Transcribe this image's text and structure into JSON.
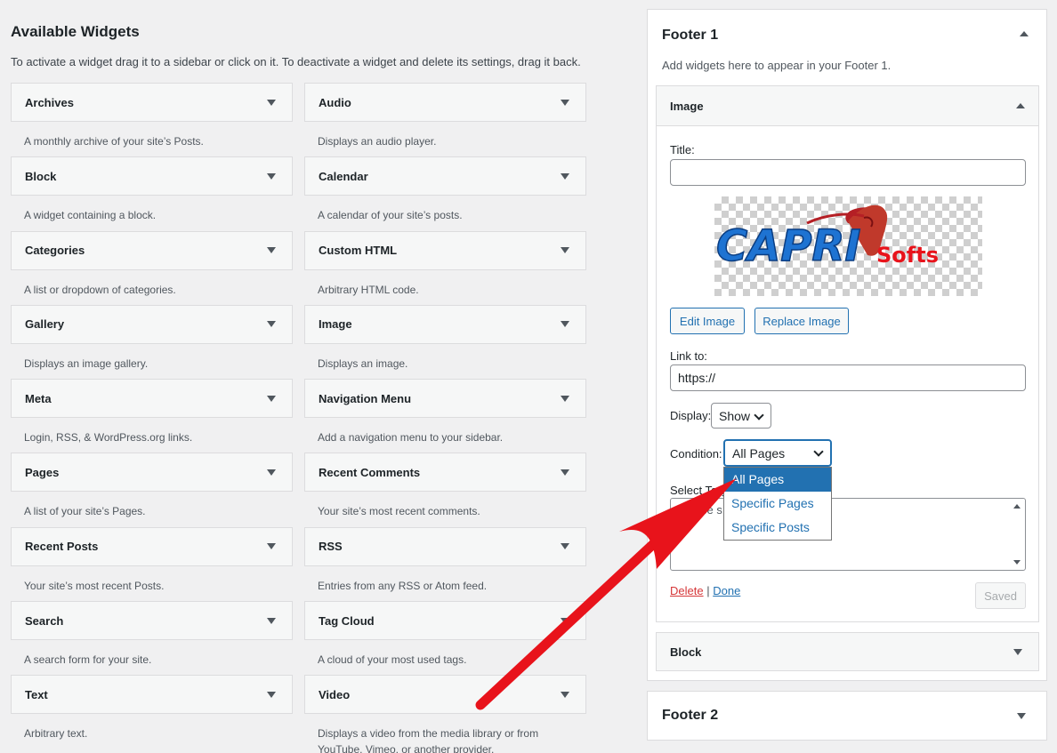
{
  "available": {
    "title": "Available Widgets",
    "description": "To activate a widget drag it to a sidebar or click on it. To deactivate a widget and delete its settings, drag it back."
  },
  "widgets": [
    {
      "name": "Archives",
      "desc": "A monthly archive of your site’s Posts."
    },
    {
      "name": "Audio",
      "desc": "Displays an audio player."
    },
    {
      "name": "Block",
      "desc": "A widget containing a block."
    },
    {
      "name": "Calendar",
      "desc": "A calendar of your site’s posts."
    },
    {
      "name": "Categories",
      "desc": "A list or dropdown of categories."
    },
    {
      "name": "Custom HTML",
      "desc": "Arbitrary HTML code."
    },
    {
      "name": "Gallery",
      "desc": "Displays an image gallery."
    },
    {
      "name": "Image",
      "desc": "Displays an image."
    },
    {
      "name": "Meta",
      "desc": "Login, RSS, & WordPress.org links."
    },
    {
      "name": "Navigation Menu",
      "desc": "Add a navigation menu to your sidebar."
    },
    {
      "name": "Pages",
      "desc": "A list of your site’s Pages."
    },
    {
      "name": "Recent Comments",
      "desc": "Your site’s most recent comments."
    },
    {
      "name": "Recent Posts",
      "desc": "Your site’s most recent Posts."
    },
    {
      "name": "RSS",
      "desc": "Entries from any RSS or Atom feed."
    },
    {
      "name": "Search",
      "desc": "A search form for your site."
    },
    {
      "name": "Tag Cloud",
      "desc": "A cloud of your most used tags."
    },
    {
      "name": "Text",
      "desc": "Arbitrary text."
    },
    {
      "name": "Video",
      "desc": "Displays a video from the media library or from YouTube, Vimeo, or another provider."
    }
  ],
  "footer1": {
    "title": "Footer 1",
    "description": "Add widgets here to appear in your Footer 1.",
    "image_widget": {
      "title": "Image",
      "title_label": "Title:",
      "title_value": "",
      "logo_text_main": "CAPRI",
      "logo_text_sub": "Softs",
      "edit_button": "Edit Image",
      "replace_button": "Replace Image",
      "link_label": "Link to:",
      "link_value": "https://",
      "display_label": "Display:",
      "display_value": "Show",
      "condition_label": "Condition:",
      "condition_value": "All Pages",
      "condition_options": [
        "All Pages",
        "Specific Pages",
        "Specific Posts"
      ],
      "select_target_label": "Select Targ",
      "textarea_placeholder": "Please s",
      "delete_link": "Delete",
      "separator": "|",
      "done_link": "Done",
      "saved_button": "Saved"
    },
    "block_widget": {
      "title": "Block"
    }
  },
  "footer2": {
    "title": "Footer 2"
  },
  "colors": {
    "accent": "#2271b1",
    "arrow": "#e8131b",
    "delete": "#d63638"
  }
}
